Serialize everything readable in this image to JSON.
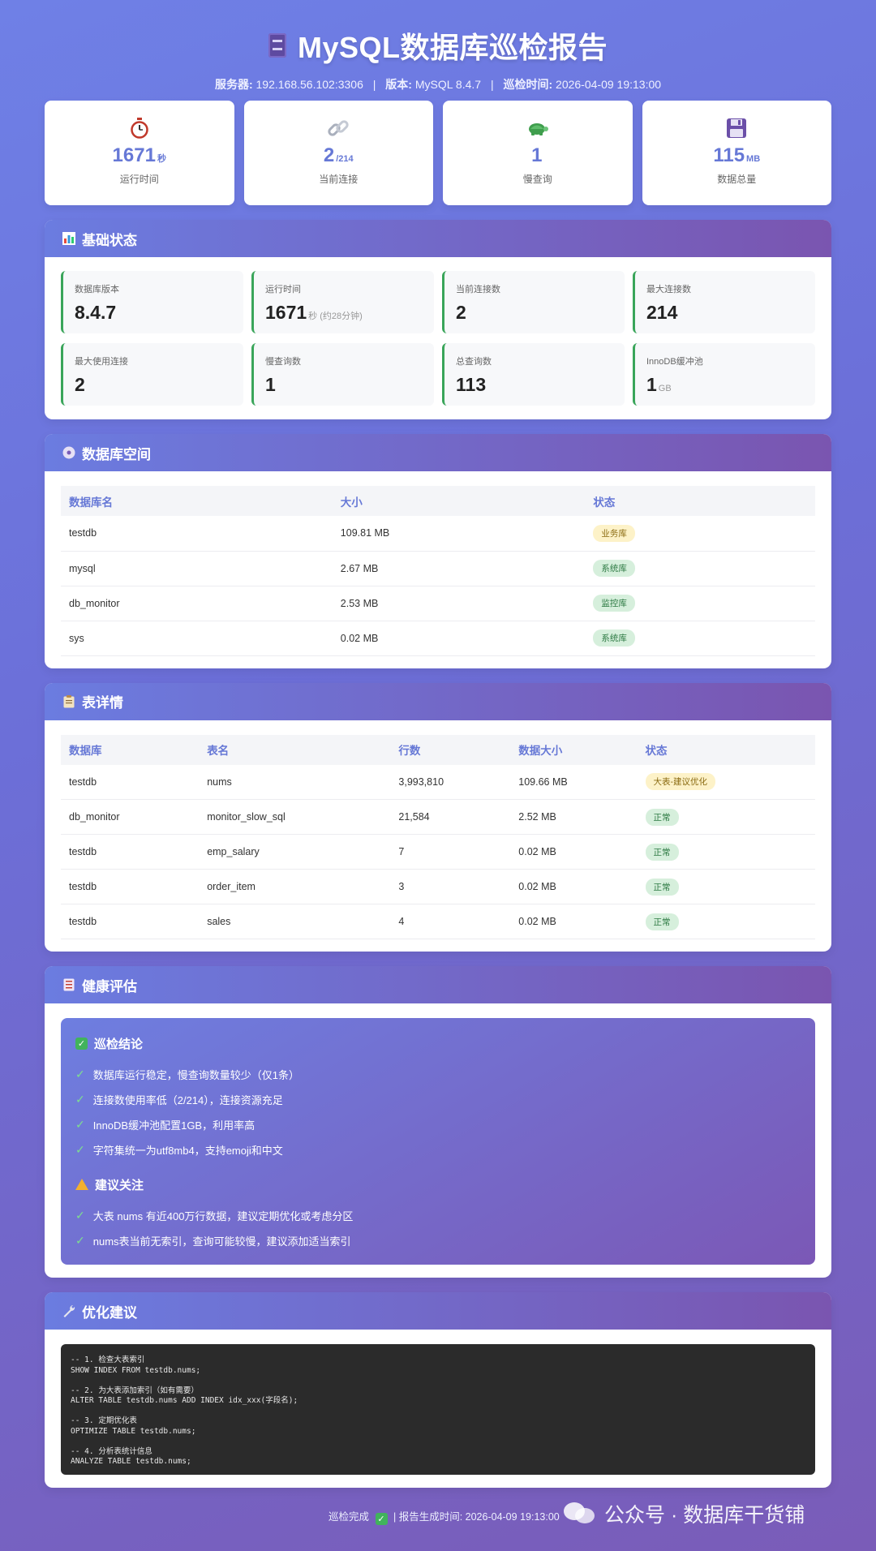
{
  "header": {
    "title": "MySQL数据库巡检报告",
    "server_label": "服务器:",
    "server_value": "192.168.56.102:3306",
    "version_label": "版本:",
    "version_value": "MySQL 8.4.7",
    "time_label": "巡检时间:",
    "time_value": "2026-04-09 19:13:00"
  },
  "stats": [
    {
      "icon": "stopwatch-icon",
      "value": "1671",
      "unit": "秒",
      "label": "运行时间"
    },
    {
      "icon": "link-icon",
      "value": "2",
      "unit": "/214",
      "label": "当前连接"
    },
    {
      "icon": "turtle-icon",
      "value": "1",
      "unit": "",
      "label": "慢查询"
    },
    {
      "icon": "floppy-disk-icon",
      "value": "115",
      "unit": "MB",
      "label": "数据总量"
    }
  ],
  "basic": {
    "title": "基础状态",
    "cells": [
      {
        "label": "数据库版本",
        "value": "8.4.7",
        "unit": ""
      },
      {
        "label": "运行时间",
        "value": "1671",
        "unit": "秒 (约28分钟)"
      },
      {
        "label": "当前连接数",
        "value": "2",
        "unit": ""
      },
      {
        "label": "最大连接数",
        "value": "214",
        "unit": ""
      },
      {
        "label": "最大使用连接",
        "value": "2",
        "unit": ""
      },
      {
        "label": "慢查询数",
        "value": "1",
        "unit": ""
      },
      {
        "label": "总查询数",
        "value": "113",
        "unit": ""
      },
      {
        "label": "InnoDB缓冲池",
        "value": "1",
        "unit": "GB"
      }
    ]
  },
  "space": {
    "title": "数据库空间",
    "headers": [
      "数据库名",
      "大小",
      "状态"
    ],
    "rows": [
      {
        "name": "testdb",
        "size": "109.81 MB",
        "status": "业务库",
        "tone": "yellow"
      },
      {
        "name": "mysql",
        "size": "2.67 MB",
        "status": "系统库",
        "tone": "green"
      },
      {
        "name": "db_monitor",
        "size": "2.53 MB",
        "status": "监控库",
        "tone": "green"
      },
      {
        "name": "sys",
        "size": "0.02 MB",
        "status": "系统库",
        "tone": "green"
      }
    ]
  },
  "tables": {
    "title": "表详情",
    "headers": [
      "数据库",
      "表名",
      "行数",
      "数据大小",
      "状态"
    ],
    "rows": [
      {
        "db": "testdb",
        "table": "nums",
        "rows": "3,993,810",
        "size": "109.66 MB",
        "status": "大表-建议优化",
        "tone": "yellow"
      },
      {
        "db": "db_monitor",
        "table": "monitor_slow_sql",
        "rows": "21,584",
        "size": "2.52 MB",
        "status": "正常",
        "tone": "green"
      },
      {
        "db": "testdb",
        "table": "emp_salary",
        "rows": "7",
        "size": "0.02 MB",
        "status": "正常",
        "tone": "green"
      },
      {
        "db": "testdb",
        "table": "order_item",
        "rows": "3",
        "size": "0.02 MB",
        "status": "正常",
        "tone": "green"
      },
      {
        "db": "testdb",
        "table": "sales",
        "rows": "4",
        "size": "0.02 MB",
        "status": "正常",
        "tone": "green"
      }
    ]
  },
  "health": {
    "title": "健康评估",
    "conclusion_title": "巡检结论",
    "conclusions": [
      "数据库运行稳定，慢查询数量较少（仅1条）",
      "连接数使用率低（2/214），连接资源充足",
      "InnoDB缓冲池配置1GB，利用率高",
      "字符集统一为utf8mb4，支持emoji和中文"
    ],
    "attention_title": "建议关注",
    "attentions": [
      "大表 nums 有近400万行数据，建议定期优化或考虑分区",
      "nums表当前无索引，查询可能较慢，建议添加适当索引"
    ]
  },
  "optimize": {
    "title": "优化建议",
    "code": "-- 1. 检查大表索引\nSHOW INDEX FROM testdb.nums;\n\n-- 2. 为大表添加索引（如有需要）\nALTER TABLE testdb.nums ADD INDEX idx_xxx(字段名);\n\n-- 3. 定期优化表\nOPTIMIZE TABLE testdb.nums;\n\n-- 4. 分析表统计信息\nANALYZE TABLE testdb.nums;"
  },
  "footer": {
    "done": "巡检完成",
    "generated": "| 报告生成时间: 2026-04-09 19:13:00",
    "watermark": "公众号 · 数据库干货铺"
  },
  "colors": {
    "accent": "#6678d6",
    "ok": "#3aa55a",
    "warn": "#f3b02f"
  }
}
